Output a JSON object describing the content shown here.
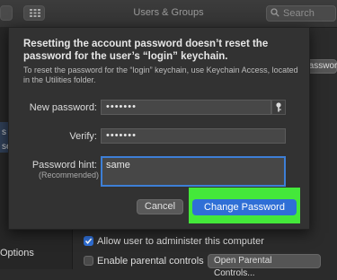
{
  "window": {
    "title": "Users & Groups",
    "search_placeholder": "Search"
  },
  "background": {
    "password_button_label": "Password...",
    "sidebar_options_label": "Options",
    "admin_checkbox_label": "Allow user to administer this computer",
    "admin_checked": true,
    "parental_checkbox_label": "Enable parental controls",
    "parental_checked": false,
    "parental_button_label": "Open Parental Controls...",
    "partial_text_1": "s",
    "partial_text_2": "se"
  },
  "sheet": {
    "heading": "Resetting the account password doesn’t reset the password for the user’s “login” keychain.",
    "note": "To reset the password for the “login” keychain, use Keychain Access, located in the Utilities folder.",
    "new_password_label": "New password:",
    "new_password_value": "•••••••",
    "verify_label": "Verify:",
    "verify_value": "•••••••",
    "hint_label": "Password hint:",
    "hint_sublabel": "(Recommended)",
    "hint_value": "same",
    "cancel_label": "Cancel",
    "change_label": "Change Password"
  },
  "colors": {
    "accent": "#2f6fd6",
    "highlight": "#44e83a"
  },
  "icons": [
    "search-icon",
    "key-icon",
    "sidebar-toggle-icon",
    "grid-icon",
    "checkmark-icon"
  ]
}
